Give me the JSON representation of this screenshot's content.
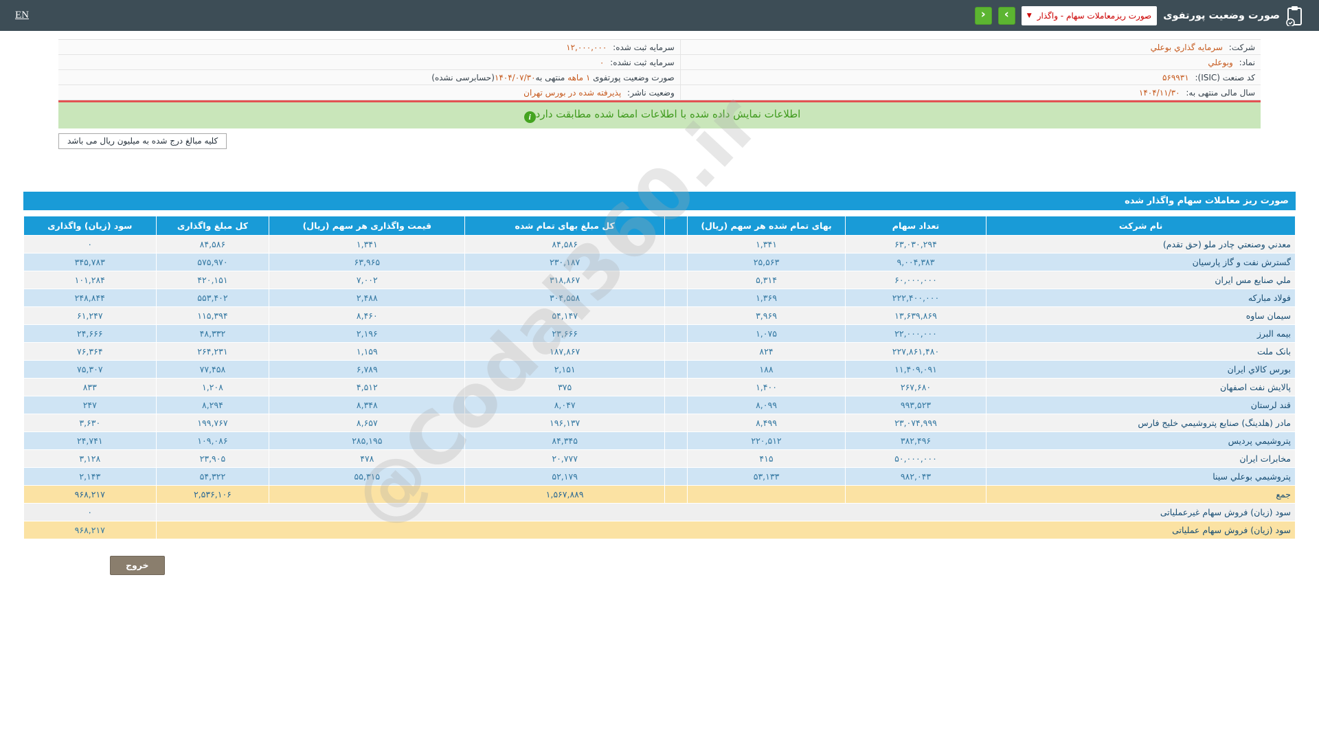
{
  "topbar": {
    "lang_link": "EN",
    "title": "صورت وضعیت پورتفوی",
    "dropdown_value": "صورت ریزمعاملات سهام - واگذار",
    "dropdown_caret": "▼",
    "nav_next_label": "›",
    "nav_prev_label": "‹"
  },
  "company_info": {
    "company_label": "شرکت:",
    "company_value": "سرمايه گذاري بوعلي",
    "symbol_label": "نماد:",
    "symbol_value": "وبوعلي",
    "isic_label": "کد صنعت (ISIC):",
    "isic_value": "۵۶۹۹۳۱",
    "fiscal_year_label": "سال مالی منتهی به:",
    "fiscal_year_value": "۱۴۰۴/۱۱/۳۰",
    "registered_capital_label": "سرمایه ثبت شده:",
    "registered_capital_value": "۱۲,۰۰۰,۰۰۰",
    "unregistered_capital_label": "سرمایه ثبت نشده:",
    "unregistered_capital_value": "۰",
    "statement_prefix": "صورت وضعیت پورتفوی",
    "statement_period": "۱ ماهه",
    "statement_mid": "منتهی به",
    "statement_date": "۱۴۰۴/۰۷/۳۰",
    "statement_suffix": "(حسابرسی نشده)",
    "issuer_status_label": "وضعیت ناشر:",
    "issuer_status_value": "پذیرفته شده در بورس تهران"
  },
  "notice": {
    "text": "اطلاعات نمایش داده شده با اطلاعات امضا شده مطابقت دارد",
    "icon": "i"
  },
  "units_note": "کلیه مبالغ درج شده به میلیون ریال می باشد",
  "table": {
    "title": "صورت ریز معاملات سهام واگذار شده",
    "headers": [
      "نام شرکت",
      "تعداد سهام",
      "بهای تمام شده هر سهم (ریال)",
      "کل مبلغ بهای تمام شده",
      "قیمت واگذاری هر سهم (ریال)",
      "کل مبلغ واگذاری",
      "سود (زیان) واگذاری"
    ],
    "rows": [
      {
        "name": "معدني وصنعتي چادر ملو (حق تقدم)",
        "shares": "۶۳,۰۳۰,۲۹۴",
        "cost_per_share": "۱,۳۴۱",
        "total_cost": "۸۴,۵۸۶",
        "transfer_price_per_share": "۱,۳۴۱",
        "total_transfer": "۸۴,۵۸۶",
        "profit": "۰"
      },
      {
        "name": "گسترش نفت و گاز پارسيان",
        "shares": "۹,۰۰۴,۳۸۳",
        "cost_per_share": "۲۵,۵۶۳",
        "total_cost": "۲۳۰,۱۸۷",
        "transfer_price_per_share": "۶۳,۹۶۵",
        "total_transfer": "۵۷۵,۹۷۰",
        "profit": "۳۴۵,۷۸۳"
      },
      {
        "name": "ملي صنايع مس ايران",
        "shares": "۶۰,۰۰۰,۰۰۰",
        "cost_per_share": "۵,۳۱۴",
        "total_cost": "۳۱۸,۸۶۷",
        "transfer_price_per_share": "۷,۰۰۲",
        "total_transfer": "۴۲۰,۱۵۱",
        "profit": "۱۰۱,۲۸۴"
      },
      {
        "name": "فولاد مباركه",
        "shares": "۲۲۲,۴۰۰,۰۰۰",
        "cost_per_share": "۱,۳۶۹",
        "total_cost": "۳۰۴,۵۵۸",
        "transfer_price_per_share": "۲,۴۸۸",
        "total_transfer": "۵۵۳,۴۰۲",
        "profit": "۲۴۸,۸۴۴"
      },
      {
        "name": "سيمان ساوه",
        "shares": "۱۳,۶۳۹,۸۶۹",
        "cost_per_share": "۳,۹۶۹",
        "total_cost": "۵۴,۱۴۷",
        "transfer_price_per_share": "۸,۴۶۰",
        "total_transfer": "۱۱۵,۳۹۴",
        "profit": "۶۱,۲۴۷"
      },
      {
        "name": "بيمه البرز",
        "shares": "۲۲,۰۰۰,۰۰۰",
        "cost_per_share": "۱,۰۷۵",
        "total_cost": "۲۳,۶۶۶",
        "transfer_price_per_share": "۲,۱۹۶",
        "total_transfer": "۴۸,۳۳۲",
        "profit": "۲۴,۶۶۶"
      },
      {
        "name": "بانک ملت",
        "shares": "۲۲۷,۸۶۱,۴۸۰",
        "cost_per_share": "۸۲۴",
        "total_cost": "۱۸۷,۸۶۷",
        "transfer_price_per_share": "۱,۱۵۹",
        "total_transfer": "۲۶۴,۲۳۱",
        "profit": "۷۶,۳۶۴"
      },
      {
        "name": "بورس کالاي ايران",
        "shares": "۱۱,۴۰۹,۰۹۱",
        "cost_per_share": "۱۸۸",
        "total_cost": "۲,۱۵۱",
        "transfer_price_per_share": "۶,۷۸۹",
        "total_transfer": "۷۷,۴۵۸",
        "profit": "۷۵,۳۰۷"
      },
      {
        "name": "پالايش نفت اصفهان",
        "shares": "۲۶۷,۶۸۰",
        "cost_per_share": "۱,۴۰۰",
        "total_cost": "۳۷۵",
        "transfer_price_per_share": "۴,۵۱۲",
        "total_transfer": "۱,۲۰۸",
        "profit": "۸۳۳"
      },
      {
        "name": "قند لرستان",
        "shares": "۹۹۳,۵۲۳",
        "cost_per_share": "۸,۰۹۹",
        "total_cost": "۸,۰۴۷",
        "transfer_price_per_share": "۸,۳۴۸",
        "total_transfer": "۸,۲۹۴",
        "profit": "۲۴۷"
      },
      {
        "name": "مادر (هلدينگ) صنايع پتروشيمي خليج فارس",
        "shares": "۲۳,۰۷۴,۹۹۹",
        "cost_per_share": "۸,۴۹۹",
        "total_cost": "۱۹۶,۱۳۷",
        "transfer_price_per_share": "۸,۶۵۷",
        "total_transfer": "۱۹۹,۷۶۷",
        "profit": "۳,۶۳۰"
      },
      {
        "name": "پتروشيمي پرديس",
        "shares": "۳۸۲,۴۹۶",
        "cost_per_share": "۲۲۰,۵۱۲",
        "total_cost": "۸۴,۳۴۵",
        "transfer_price_per_share": "۲۸۵,۱۹۵",
        "total_transfer": "۱۰۹,۰۸۶",
        "profit": "۲۴,۷۴۱"
      },
      {
        "name": "مخابرات ايران",
        "shares": "۵۰,۰۰۰,۰۰۰",
        "cost_per_share": "۴۱۵",
        "total_cost": "۲۰,۷۷۷",
        "transfer_price_per_share": "۴۷۸",
        "total_transfer": "۲۳,۹۰۵",
        "profit": "۳,۱۲۸"
      },
      {
        "name": "پتروشيمي بوعلي سينا",
        "shares": "۹۸۲,۰۴۳",
        "cost_per_share": "۵۳,۱۳۳",
        "total_cost": "۵۲,۱۷۹",
        "transfer_price_per_share": "۵۵,۳۱۵",
        "total_transfer": "۵۴,۳۲۲",
        "profit": "۲,۱۴۳"
      }
    ],
    "total_row": {
      "label": "جمع",
      "total_cost": "۱,۵۶۷,۸۸۹",
      "total_transfer": "۲,۵۳۶,۱۰۶",
      "profit": "۹۶۸,۲۱۷"
    },
    "non_operating_row": {
      "label": "سود (زیان) فروش سهام غیرعملیاتی",
      "value": "۰"
    },
    "operating_row": {
      "label": "سود (زیان) فروش سهام عملیاتی",
      "value": "۹۶۸,۲۱۷"
    }
  },
  "watermark": "@Codal360.ir",
  "exit_button": "خروج",
  "colors": {
    "topbar": "#3d4d56",
    "accent_blue": "#199bd7",
    "row_alt_blue": "#cfe4f4",
    "row_total_yellow": "#fbe2a3",
    "value_orange": "#c65a1e",
    "notice_bg": "#c9e6ba",
    "notice_text": "#3f9a1d",
    "nav_green": "#5cb531",
    "dropdown_red": "#cc0000",
    "divider_red": "#e25353"
  }
}
